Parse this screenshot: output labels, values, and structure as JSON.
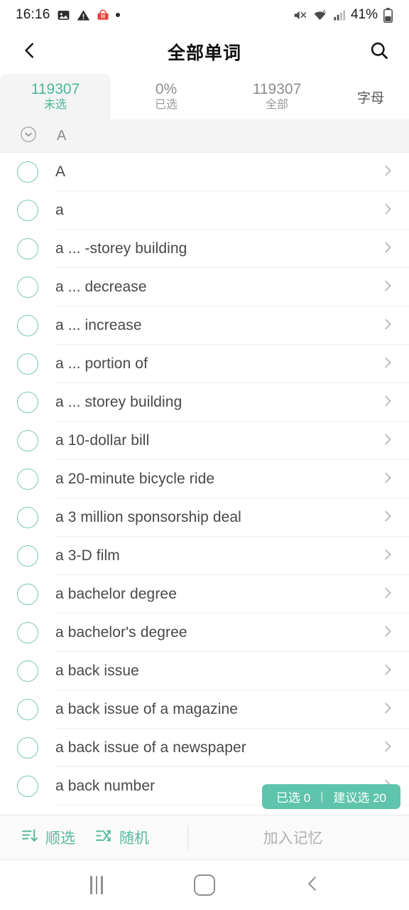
{
  "status_bar": {
    "time": "16:16",
    "left_icons": [
      "image-icon",
      "warning-icon",
      "app-notification-icon",
      "dot-icon"
    ],
    "right_icons": [
      "volume-mute-icon",
      "wifi-icon",
      "signal-icon",
      "battery-icon"
    ],
    "battery_percent": "41%"
  },
  "header": {
    "back_icon": "chevron-left-icon",
    "title": "全部单词",
    "search_icon": "search-icon"
  },
  "tabs": [
    {
      "value": "119307",
      "label": "未选",
      "active": true
    },
    {
      "value": "0%",
      "label": "已选",
      "active": false
    },
    {
      "value": "119307",
      "label": "全部",
      "active": false
    }
  ],
  "tab_mode": {
    "label": "字母"
  },
  "section": {
    "collapse_icon": "chevron-down-circle-icon",
    "letter": "A"
  },
  "list": {
    "chevron_icon": "chevron-right-icon",
    "rows": [
      {
        "word": "A",
        "checked": false
      },
      {
        "word": "a",
        "checked": false
      },
      {
        "word": "a ... -storey building",
        "checked": false
      },
      {
        "word": "a ... decrease",
        "checked": false
      },
      {
        "word": "a ... increase",
        "checked": false
      },
      {
        "word": "a ... portion of",
        "checked": false
      },
      {
        "word": "a ... storey building",
        "checked": false
      },
      {
        "word": "a 10-dollar bill",
        "checked": false
      },
      {
        "word": "a 20-minute bicycle ride",
        "checked": false
      },
      {
        "word": "a 3 million sponsorship deal",
        "checked": false
      },
      {
        "word": "a 3-D film",
        "checked": false
      },
      {
        "word": "a bachelor degree",
        "checked": false
      },
      {
        "word": "a bachelor's degree",
        "checked": false
      },
      {
        "word": "a back issue",
        "checked": false
      },
      {
        "word": "a back issue of a magazine",
        "checked": false
      },
      {
        "word": "a back issue of a newspaper",
        "checked": false
      },
      {
        "word": "a back number",
        "checked": false
      }
    ]
  },
  "selection_badge": {
    "selected_label": "已选 0",
    "separator": "|",
    "suggested_label": "建议选 20"
  },
  "toolbar": {
    "sort_icon": "list-sort-down-icon",
    "sort_label": "顺选",
    "random_icon": "shuffle-icon",
    "random_label": "随机",
    "action_label": "加入记忆"
  },
  "nav_bar": {
    "recents_icon": "recents-icon",
    "home_icon": "home-icon",
    "back_icon": "nav-back-icon"
  },
  "colors": {
    "accent": "#4cb79b",
    "badge_bg": "#5ec4ab",
    "checkbox_border": "#79c7b3",
    "text_primary": "#484848",
    "text_muted": "#9a9a9a"
  }
}
